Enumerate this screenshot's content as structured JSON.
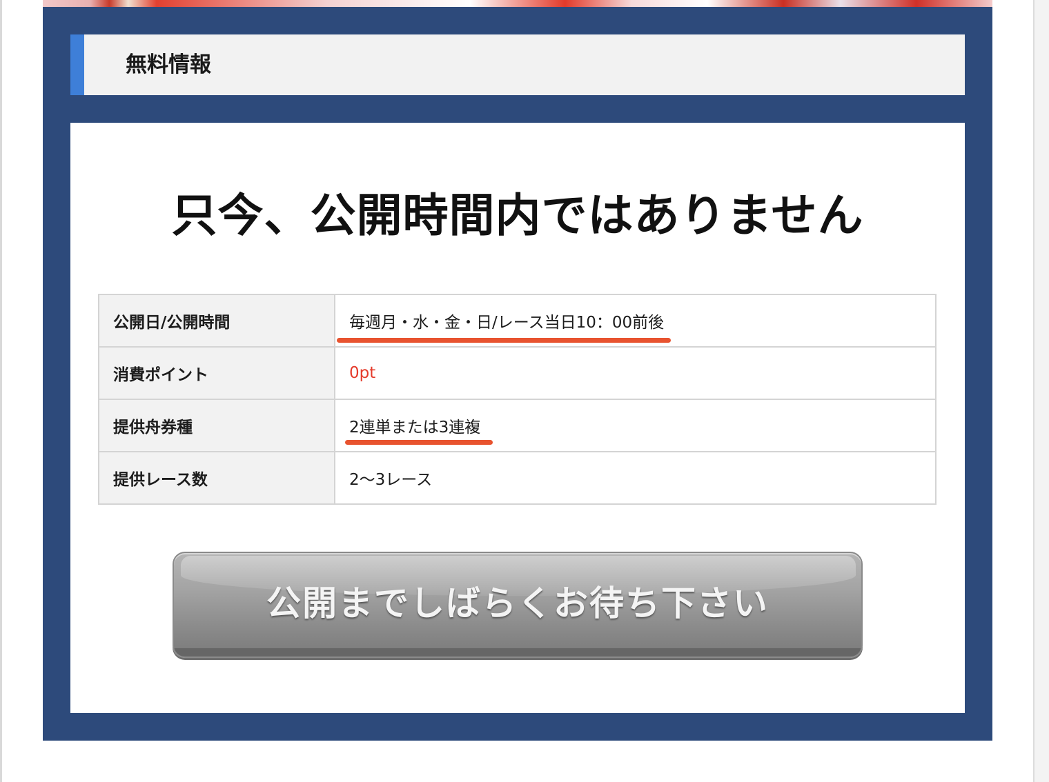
{
  "section": {
    "title": "無料情報"
  },
  "notice": {
    "message": "只今、公開時間内ではありません"
  },
  "info_table": {
    "rows": [
      {
        "label": "公開日/公開時間",
        "value": "毎週月・水・金・日/レース当日10：00前後"
      },
      {
        "label": "消費ポイント",
        "value": "0pt"
      },
      {
        "label": "提供舟券種",
        "value": "2連単または3連複"
      },
      {
        "label": "提供レース数",
        "value": "2〜3レース"
      }
    ]
  },
  "wait_button": {
    "label": "公開までしばらくお待ち下さい"
  },
  "colors": {
    "panel_bg": "#2d4a7b",
    "accent": "#3e7fd8",
    "points_text": "#e53b2b",
    "underline_marker": "#e8532f",
    "button_gray": "#9a9a9a"
  }
}
